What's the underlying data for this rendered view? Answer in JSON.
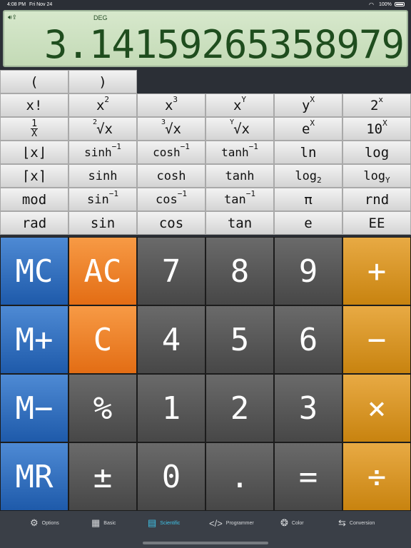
{
  "status": {
    "time": "4:08 PM",
    "date": "Fri Nov 24",
    "battery": "100%"
  },
  "display": {
    "icons": "🔊︎⇪",
    "mode": "DEG",
    "value": "3.14159265358979"
  },
  "sci_rows": [
    [
      "(",
      ")"
    ],
    [
      "x!",
      "x2",
      "x3",
      "xY",
      "yX",
      "2x"
    ],
    [
      "1/X",
      "2√x",
      "3√x",
      "Y√x",
      "ex",
      "10x"
    ],
    [
      "⌊x⌋",
      "sinh-1",
      "cosh-1",
      "tanh-1",
      "ln",
      "log"
    ],
    [
      "⌈x⌉",
      "sinh",
      "cosh",
      "tanh",
      "log2",
      "logY"
    ],
    [
      "mod",
      "sin-1",
      "cos-1",
      "tan-1",
      "π",
      "rnd"
    ],
    [
      "rad",
      "sin",
      "cos",
      "tan",
      "e",
      "EE"
    ]
  ],
  "keys": {
    "mc": "MC",
    "ac": "AC",
    "k7": "7",
    "k8": "8",
    "k9": "9",
    "plus": "+",
    "mplus": "M+",
    "c": "C",
    "k4": "4",
    "k5": "5",
    "k6": "6",
    "minus": "−",
    "mminus": "M−",
    "pct": "%",
    "k1": "1",
    "k2": "2",
    "k3": "3",
    "times": "×",
    "mr": "MR",
    "pm": "±",
    "k0": "0",
    "dot": ".",
    "eq": "=",
    "div": "÷"
  },
  "tabs": {
    "options": "Options",
    "basic": "Basic",
    "scientific": "Scientific",
    "programmer": "Programmer",
    "color": "Color",
    "conversion": "Conversion"
  },
  "colors": {
    "display_text": "#1f4d1e",
    "active_tab": "#3fc3e8"
  }
}
